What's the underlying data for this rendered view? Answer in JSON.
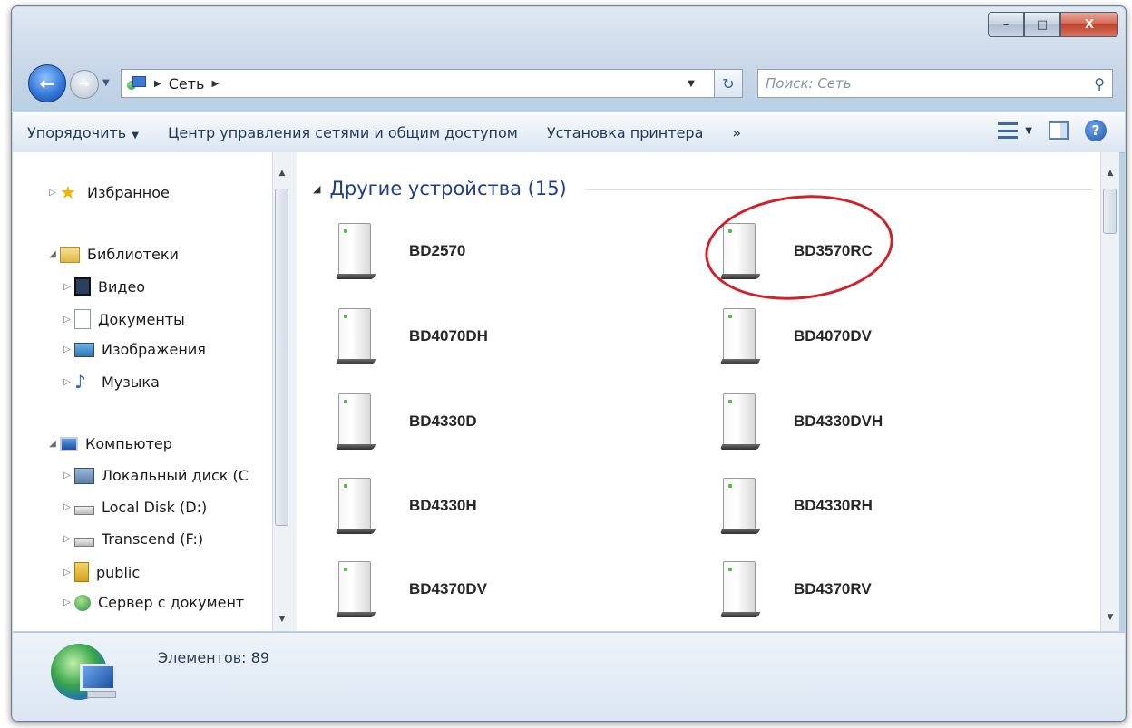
{
  "window": {
    "caption_buttons": {
      "minimize": "–",
      "maximize": "□",
      "close": "X"
    }
  },
  "address": {
    "path": [
      "Сеть"
    ],
    "search_placeholder": "Поиск: Сеть"
  },
  "toolbar": {
    "organize": "Упорядочить",
    "network_center": "Центр управления сетями и общим доступом",
    "add_printer": "Установка принтера",
    "more": "»"
  },
  "nav": {
    "favorites": "Избранное",
    "libraries": "Библиотеки",
    "video": "Видео",
    "documents": "Документы",
    "images": "Изображения",
    "music": "Музыка",
    "computer": "Компьютер",
    "local_c": "Локальный диск (C",
    "local_d": "Local Disk (D:)",
    "transcend": "Transcend (F:)",
    "public": "public",
    "server": "Сервер с документ"
  },
  "content": {
    "group_title": "Другие устройства (15)",
    "devices": [
      "BD2570",
      "BD3570RC",
      "BD4070DH",
      "BD4070DV",
      "BD4330D",
      "BD4330DVH",
      "BD4330H",
      "BD4330RH",
      "BD4370DV",
      "BD4370RV"
    ],
    "highlighted_device": "BD3570RC",
    "highlight_color": "#d1202a"
  },
  "details": {
    "item_count": "Элементов: 89"
  }
}
